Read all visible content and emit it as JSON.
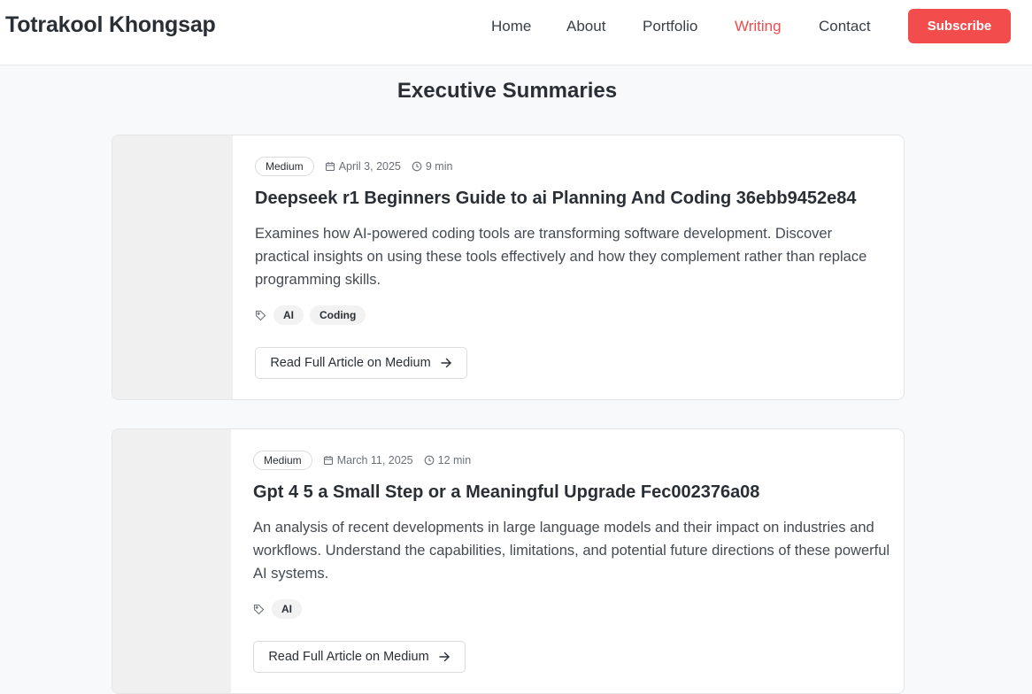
{
  "header": {
    "brand": "Totrakool Khongsap",
    "nav": [
      "Home",
      "About",
      "Portfolio",
      "Writing",
      "Contact"
    ],
    "active_nav": "Writing",
    "subscribe_label": "Subscribe"
  },
  "page": {
    "title": "Executive Summaries"
  },
  "articles": [
    {
      "source": "Medium",
      "date": "April 3, 2025",
      "read_time": "9 min",
      "title": "Deepseek r1 Beginners Guide to ai Planning And Coding 36ebb9452e84",
      "description": "Examines how AI-powered coding tools are transforming software development. Discover practical insights on using these tools effectively and how they complement rather than replace programming skills.",
      "tags": [
        "AI",
        "Coding"
      ],
      "cta": "Read Full Article on Medium"
    },
    {
      "source": "Medium",
      "date": "March 11, 2025",
      "read_time": "12 min",
      "title": "Gpt 4 5 a Small Step or a Meaningful Upgrade Fec002376a08",
      "description": "An analysis of recent developments in large language models and their impact on industries and workflows. Understand the capabilities, limitations, and potential future directions of these powerful AI systems.",
      "tags": [
        "AI"
      ],
      "cta": "Read Full Article on Medium"
    }
  ],
  "icons": {
    "date": "calendar-icon",
    "read_time": "clock-icon",
    "tags": "tag-icon",
    "cta": "arrow-right-icon"
  },
  "colors": {
    "accent": "#f24c4c",
    "background": "#f8f9fa",
    "card": "#ffffff",
    "thumbnail": "#f0f0f0",
    "text": "#2a2f36"
  }
}
